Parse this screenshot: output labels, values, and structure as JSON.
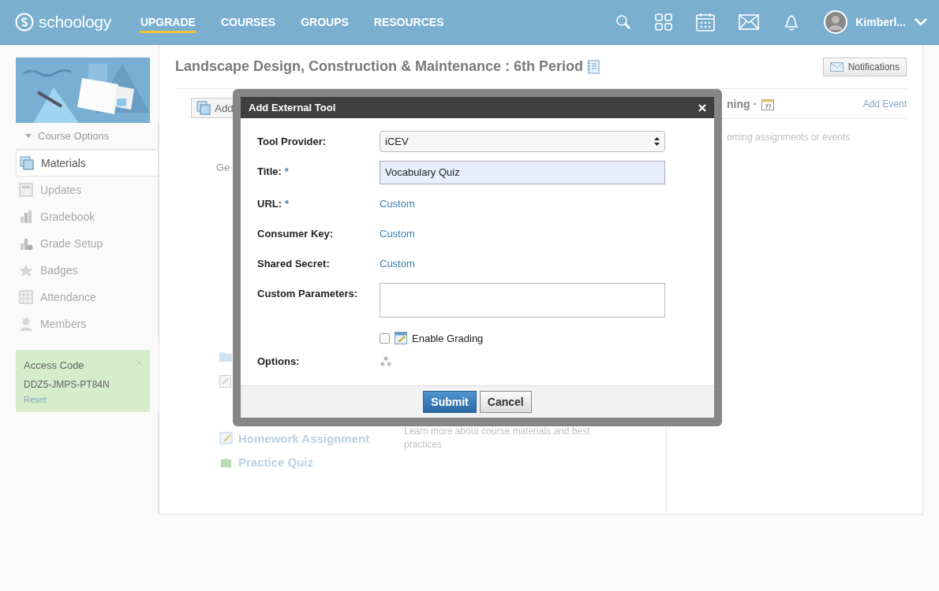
{
  "header": {
    "logo": "schoology",
    "nav": [
      {
        "label": "UPGRADE",
        "selected": true
      },
      {
        "label": "COURSES",
        "selected": false
      },
      {
        "label": "GROUPS",
        "selected": false
      },
      {
        "label": "RESOURCES",
        "selected": false
      }
    ],
    "user_name": "Kimberl..."
  },
  "sidebar": {
    "course_options": "Course Options",
    "items": [
      {
        "label": "Materials",
        "kind": "materials",
        "selected": true
      },
      {
        "label": "Updates",
        "kind": "updates",
        "selected": false
      },
      {
        "label": "Gradebook",
        "kind": "gradebook",
        "selected": false
      },
      {
        "label": "Grade Setup",
        "kind": "gradesetup",
        "selected": false
      },
      {
        "label": "Badges",
        "kind": "badges",
        "selected": false
      },
      {
        "label": "Attendance",
        "kind": "attendance",
        "selected": false
      },
      {
        "label": "Members",
        "kind": "members",
        "selected": false
      }
    ],
    "access_code": {
      "title": "Access Code",
      "code": "DDZ5-JMPS-PT84N",
      "reset": "Reset"
    }
  },
  "course": {
    "title": "Landscape Design, Construction & Maintenance : 6th Period",
    "notifications_button": "Notifications",
    "add_materials": "Add",
    "section_fragment": "Ge",
    "upcoming_fragment": "ning ·",
    "add_event": "Add Event",
    "upcoming_empty": "oming assignments or events",
    "materials": [
      {
        "label": "Homework Assignment",
        "kind": "homework"
      },
      {
        "label": "Practice Quiz",
        "kind": "quiz"
      }
    ],
    "learn_more": "Learn more about course materials and best practices"
  },
  "modal": {
    "title": "Add External Tool",
    "fields": [
      {
        "kind": "select",
        "label": "Tool Provider:",
        "value": "iCEV"
      },
      {
        "kind": "text",
        "label": "Title:",
        "required_mark": "*",
        "value": "Vocabulary Quiz"
      },
      {
        "kind": "link",
        "label": "URL:",
        "required_mark": "*",
        "value": "Custom"
      },
      {
        "kind": "link",
        "label": "Consumer Key:",
        "value": "Custom"
      },
      {
        "kind": "link",
        "label": "Shared Secret:",
        "value": "Custom"
      },
      {
        "kind": "textarea",
        "label": "Custom Parameters:"
      },
      {
        "kind": "checkbox",
        "label": "Enable Grading",
        "checked": false
      },
      {
        "kind": "spinner",
        "label": "Options:"
      }
    ],
    "buttons": [
      {
        "label": "Submit",
        "kind": "primary"
      },
      {
        "label": "Cancel",
        "kind": "secondary"
      }
    ]
  }
}
